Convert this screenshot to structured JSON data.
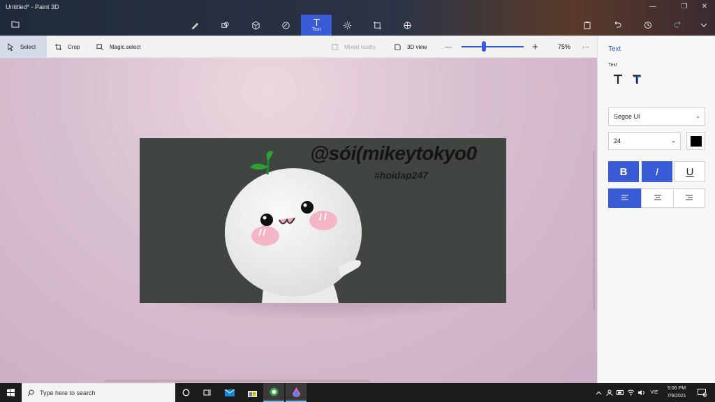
{
  "titlebar": {
    "title": "Untitled* - Paint 3D",
    "minimize": "—",
    "restore": "❐",
    "close": "✕",
    "active_tool_label": "Text"
  },
  "toolbar": {
    "select": "Select",
    "crop": "Crop",
    "magic_select": "Magic select",
    "mixed_reality": "Mixed reality",
    "view_3d": "3D view",
    "zoom_minus": "—",
    "zoom_plus": "+",
    "zoom_level": 0.75,
    "zoom_label": "75%",
    "more": "···"
  },
  "canvas": {
    "title_text": "@sói(mikeytokyo0",
    "hashtag_text": "#hoidap247"
  },
  "panel": {
    "title": "Text",
    "subtitle": "Text",
    "font_family": "Segoe UI",
    "font_size": "24",
    "color": "#000000",
    "bold": "B",
    "italic": "I",
    "underline": "U"
  },
  "taskbar": {
    "search_placeholder": "Type here to search",
    "language": "VIE",
    "time": "5:06 PM",
    "date": "7/9/2021",
    "notifications": "18"
  }
}
